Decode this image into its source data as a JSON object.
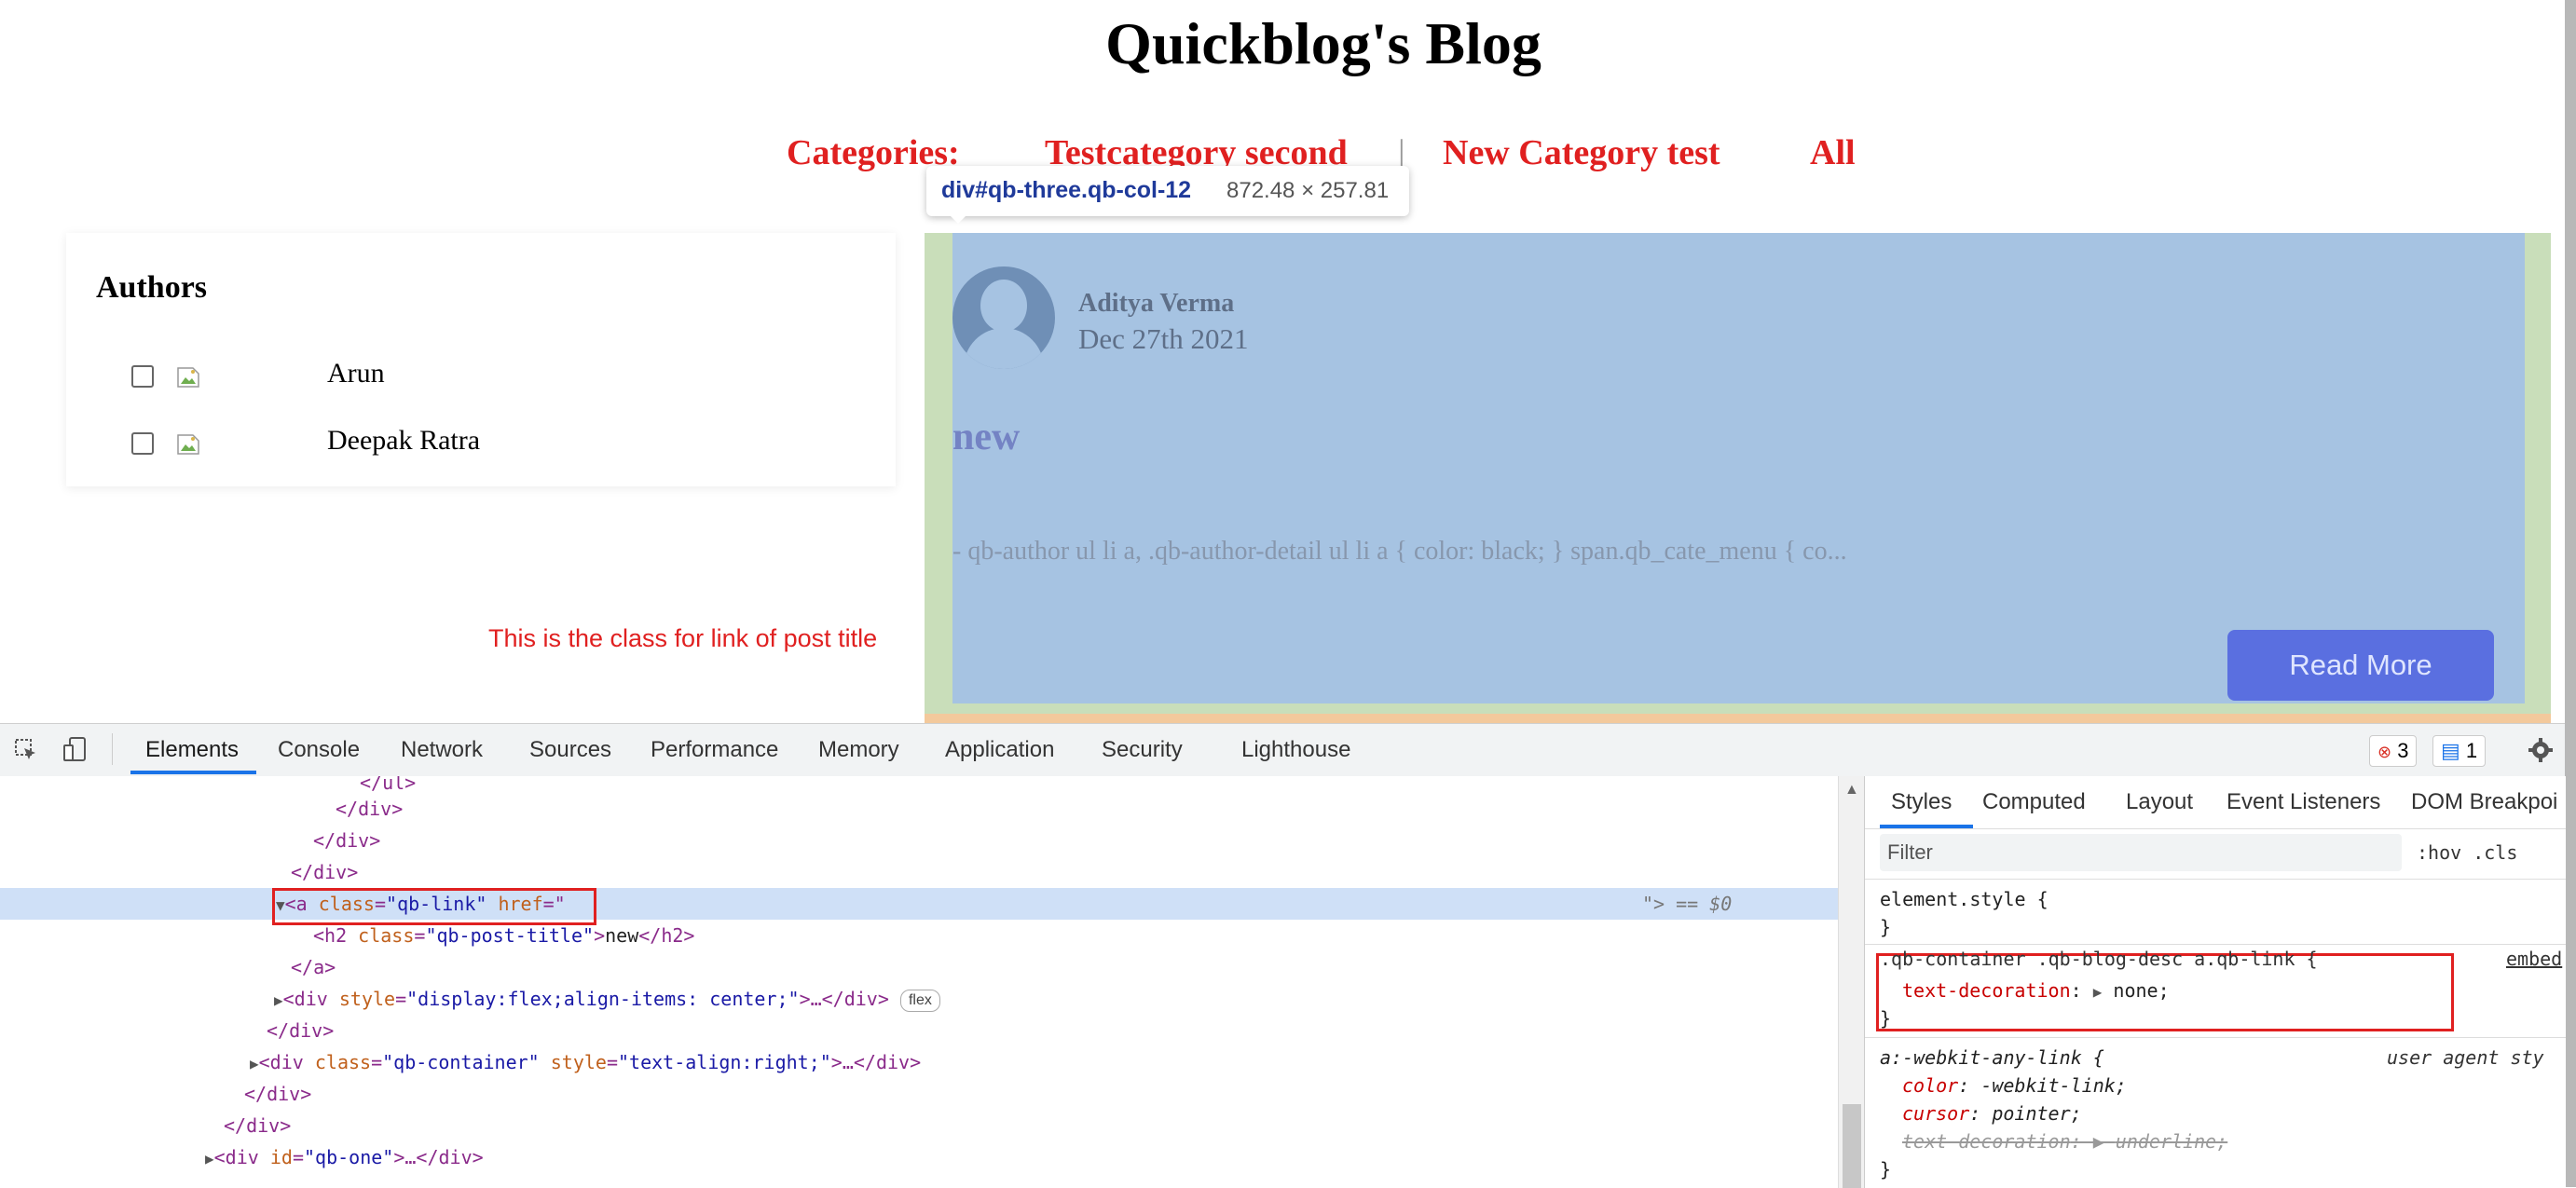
{
  "page": {
    "blog_title": "Quickblog's Blog",
    "categories_label": "Categories:",
    "categories": [
      "Testcategory second",
      "New Category test",
      "All"
    ],
    "category_separator": "|",
    "authors": {
      "title": "Authors",
      "items": [
        {
          "name": "Arun",
          "checked": false
        },
        {
          "name": "Deepak Ratra",
          "checked": false
        }
      ]
    },
    "annotation_note": "This is the class for link of post title",
    "post": {
      "author": "Aditya Verma",
      "date": "Dec 27th 2021",
      "title": "new",
      "excerpt": "- qb-author ul li a, .qb-author-detail ul li a { color: black; } span.qb_cate_menu { co...",
      "read_more": "Read More"
    },
    "inspect_tooltip": {
      "selector": "div#qb-three.qb-col-12",
      "dimensions": "872.48 × 257.81"
    }
  },
  "devtools": {
    "tabs": [
      "Elements",
      "Console",
      "Network",
      "Sources",
      "Performance",
      "Memory",
      "Application",
      "Security",
      "Lighthouse"
    ],
    "active_tab": "Elements",
    "error_count": "3",
    "message_count": "1",
    "dom_lines": [
      {
        "text": "</ul>"
      },
      {
        "text": "</div>"
      },
      {
        "text": "</div>"
      },
      {
        "text": "</div>"
      },
      {
        "tag": "<a ",
        "attr": "class",
        "eq": "=",
        "val": "\"qb-link\"",
        "attr2": " href",
        "eq2": "=\"",
        "end": "",
        "tail": "\"> == $0"
      },
      {
        "tag": "<h2 ",
        "attr": "class",
        "eq": "=",
        "val": "\"qb-post-title\"",
        "close": ">",
        "text": "new",
        "endtag": "</h2>"
      },
      {
        "text": "</a>"
      },
      {
        "tag": "<div ",
        "attr": "style",
        "eq": "=",
        "val": "\"display:flex;align-items: center;\"",
        "close": ">…</div>",
        "pill": "flex"
      },
      {
        "text": "</div>"
      },
      {
        "tag": "<div ",
        "attr": "class",
        "eq": "=",
        "val": "\"qb-container\"",
        "attr2": " style",
        "eq2": "=",
        "val2": "\"text-align:right;\"",
        "close": ">…</div>"
      },
      {
        "text": "</div>"
      },
      {
        "text": "</div>"
      },
      {
        "tag": "<div ",
        "attr": "id",
        "eq": "=",
        "val": "\"qb-one\"",
        "close": ">…</div>"
      }
    ],
    "styles": {
      "tabs": [
        "Styles",
        "Computed",
        "Layout",
        "Event Listeners",
        "DOM Breakpoi"
      ],
      "filter_placeholder": "Filter",
      "filter_buttons": ":hov  .cls",
      "element_style_open": "element.style {",
      "close_brace": "}",
      "rule1_selector": ".qb-container .qb-blog-desc a.qb-link {",
      "rule1_source": "embed",
      "rule1_prop": "text-decoration",
      "rule1_value": "none;",
      "rule2_selector": "a:-webkit-any-link {",
      "rule2_source": "user agent sty",
      "rule2_props": [
        {
          "name": "color",
          "value": "-webkit-link;"
        },
        {
          "name": "cursor",
          "value": "pointer;"
        },
        {
          "name": "text-decoration",
          "value": "underline;"
        }
      ]
    }
  },
  "colors": {
    "accent_red": "#e02020",
    "highlight_content": "#a6c3e2",
    "highlight_padding": "#c9deba",
    "button_blue": "#5a6fe0",
    "devtools_blue": "#1a73e8"
  }
}
